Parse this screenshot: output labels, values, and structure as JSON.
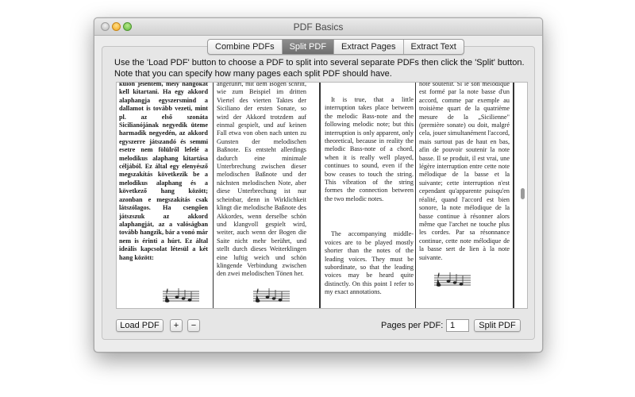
{
  "window": {
    "title": "PDF Basics"
  },
  "tabs": [
    {
      "label": "Combine PDFs",
      "active": false
    },
    {
      "label": "Split PDF",
      "active": true
    },
    {
      "label": "Extract Pages",
      "active": false
    },
    {
      "label": "Extract Text",
      "active": false
    }
  ],
  "instructions": "Use the 'Load PDF' button to choose a PDF to split into several separate PDFs then click the 'Split' button. Note that you can specify how many pages each split PDF should have.",
  "preview": {
    "columns": [
      "külön jelentem, mely hangokat kell kitartani. Ha egy akkord alaphangja egyszersmind a dallamot is tovább vezeti, mint pl. az első szonáta Sicilianójának negyedik üteme harmadik negyedén, az akkord egyszerre játszandó és semmi esetre nem fölülről lefelé a melodikus alaphang kitartása céljából. Ez által egy elenyésző megszakítás következik be a melodikus alaphang és a következő hang között; azonban e megszakítás csak látszólagos. Ha csengően játszszuk az akkord alaphangját, az a valóságban tovább hangzik, bár a vonó már nem is érinti a húrt. Ez által ideális kapcsolat létesül a két hang között:",
      "angeführt, mit dem Bogen schritt, wie zum Beispiel im dritten Viertel des vierten Taktes der Siciliano der ersten Sonate, so wird der Akkord trotzdem auf einmal gespielt, und auf keinen Fall etwa von oben nach unten zu Gunsten der melodischen Baßnote. Es entsteht allerdings dadurch eine minimale Unterbrechung zwischen dieser melodischen Baßnote und der nächsten melodischen Note, aber diese Unterbrechung ist nur scheinbar, denn in Wirklichkeit klingt die melodische Baßnote des Akkordes, wenn derselbe schön und klangvoll gespielt wird, weiter, auch wenn der Bogen die Saite nicht mehr berührt, und stellt durch dieses Weiterklingen eine luftig weich und schön klingende Verbindung zwischen den zwei melodischen Tönen her.",
      "It is true, that a little interruption takes place between the melodic Bass-note and the following melodic note; but this interruption is only apparent, only theoretical, because in reality the melodic Bass-note of a chord, when it is really well played, continues to sound, even if the bow ceases to touch the string. This vibration of the string formes the connection between the two melodic notes.",
      "The accompanying middle-voices are to be played mostly shorter than the notes of the leading voices. They must be subordinate, so that the leading voices may be heard quite distinctly. On this point I refer to my exact annotations.",
      "note soutenir. Si le son mélodique est formé par la note basse d'un accord, comme par exemple au troisième quart de la quatrième mesure de la „Sicilienne\" (première sonate) ou doit, malgré cela, jouer simultanément l'accord, mais surtout pas de haut en bas, afin de pouvoir soutenir la note basse. Il se produit, il est vrai, une légère interruption entre cette note mélodique de la basse et la suivante; cette interruption n'est cependant qu'apparente puisqu'en réalité, quand l'accord est bien sonore, la note mélodique de la basse continue à résonner alors même que l'archet ne touche plus les cordes. Par sa résonnance continue, cette note mélodique de la basse sert de lien à la note suivante."
    ]
  },
  "controls": {
    "load_label": "Load PDF",
    "plus_label": "+",
    "minus_label": "−",
    "pages_label": "Pages per PDF:",
    "pages_value": "1",
    "split_label": "Split PDF"
  }
}
